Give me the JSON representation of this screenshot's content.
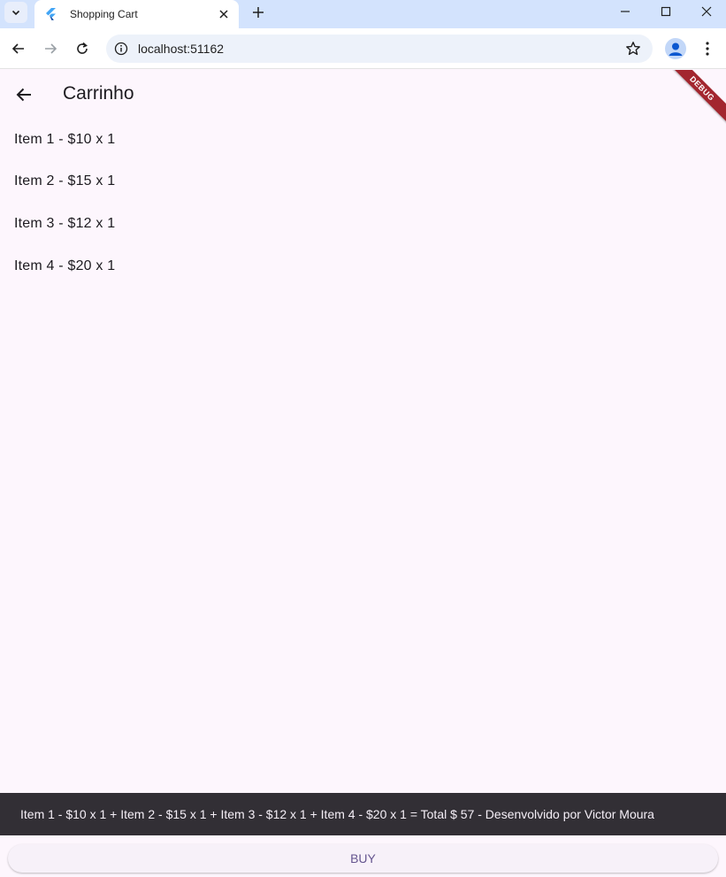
{
  "browser": {
    "tab_title": "Shopping Cart",
    "url": "localhost:51162"
  },
  "app": {
    "title": "Carrinho",
    "debug_label": "DEBUG",
    "items": [
      {
        "label": "Item 1 - $10 x 1"
      },
      {
        "label": "Item 2 - $15 x 1"
      },
      {
        "label": "Item 3 - $12 x 1"
      },
      {
        "label": "Item 4 - $20 x 1"
      }
    ],
    "snackbar_text": "Item 1 - $10 x 1 + Item 2 - $15 x 1 + Item 3 - $12 x 1 + Item 4 - $20 x 1 = Total $ 57 - Desenvolvido por Victor Moura",
    "buy_label": "BUY"
  },
  "colors": {
    "background": "#fdf6fd",
    "snackbar": "#322f35",
    "button_text": "#65558f",
    "debug_banner": "#a3262f",
    "tabbar": "#d3e3fd"
  },
  "icons": {
    "tab_search": "chevron-down-icon",
    "favicon": "flutter-icon",
    "tab_close": "close-icon",
    "new_tab": "plus-icon",
    "minimize": "minimize-icon",
    "maximize": "maximize-icon",
    "close_window": "close-icon",
    "back": "arrow-left-icon",
    "forward": "arrow-right-icon",
    "reload": "reload-icon",
    "site_info": "info-icon",
    "bookmark": "star-icon",
    "profile": "avatar-icon",
    "menu": "kebab-menu-icon",
    "app_back": "arrow-left-icon"
  }
}
